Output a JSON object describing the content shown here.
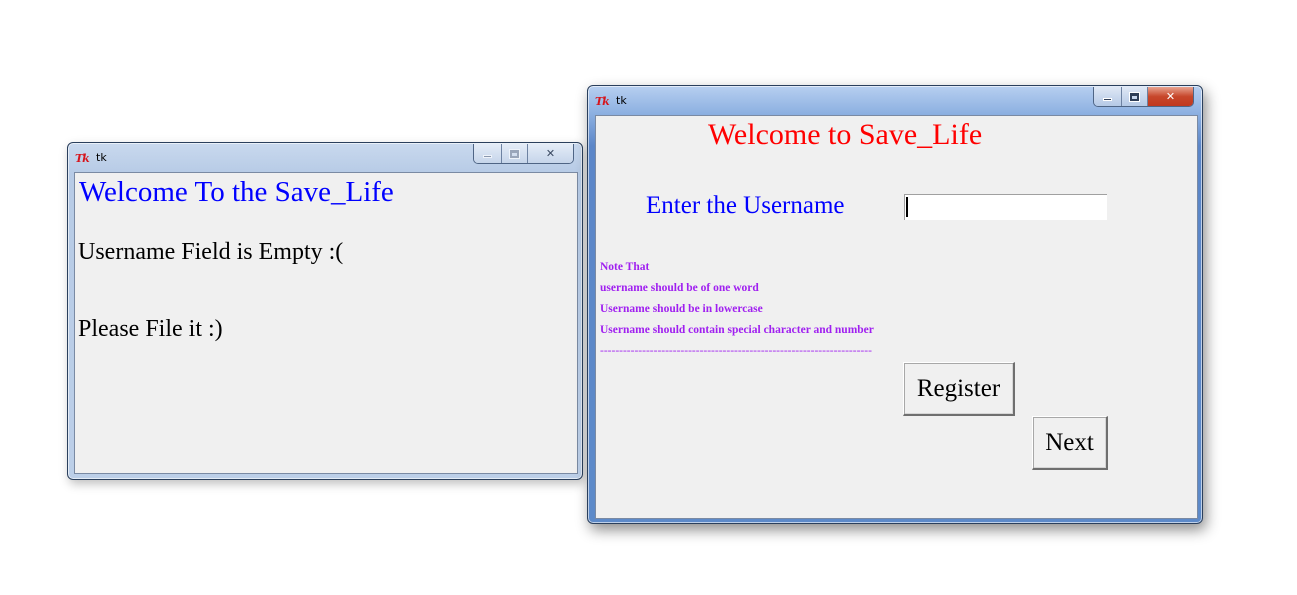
{
  "windows": {
    "left": {
      "title": "tk",
      "icon": "tk-feather-icon",
      "heading": "Welcome To the Save_Life",
      "message_line1": "Username Field is Empty :(",
      "message_line2": "Please File it :)",
      "colors": {
        "heading": "#0000ff",
        "text": "#000000"
      }
    },
    "right": {
      "title": "tk",
      "icon": "tk-feather-icon",
      "heading": "Welcome to Save_Life",
      "username_label": "Enter the Username",
      "username_value": "",
      "notes": [
        "Note That",
        "username should be  of one word",
        "Username should be in lowercase",
        "Username should contain special character and number",
        "-----------------------------------------------------------------------"
      ],
      "register_label": "Register",
      "next_label": "Next",
      "colors": {
        "heading": "#ff0000",
        "label": "#0000ff",
        "notes": "#a020f0"
      }
    }
  }
}
